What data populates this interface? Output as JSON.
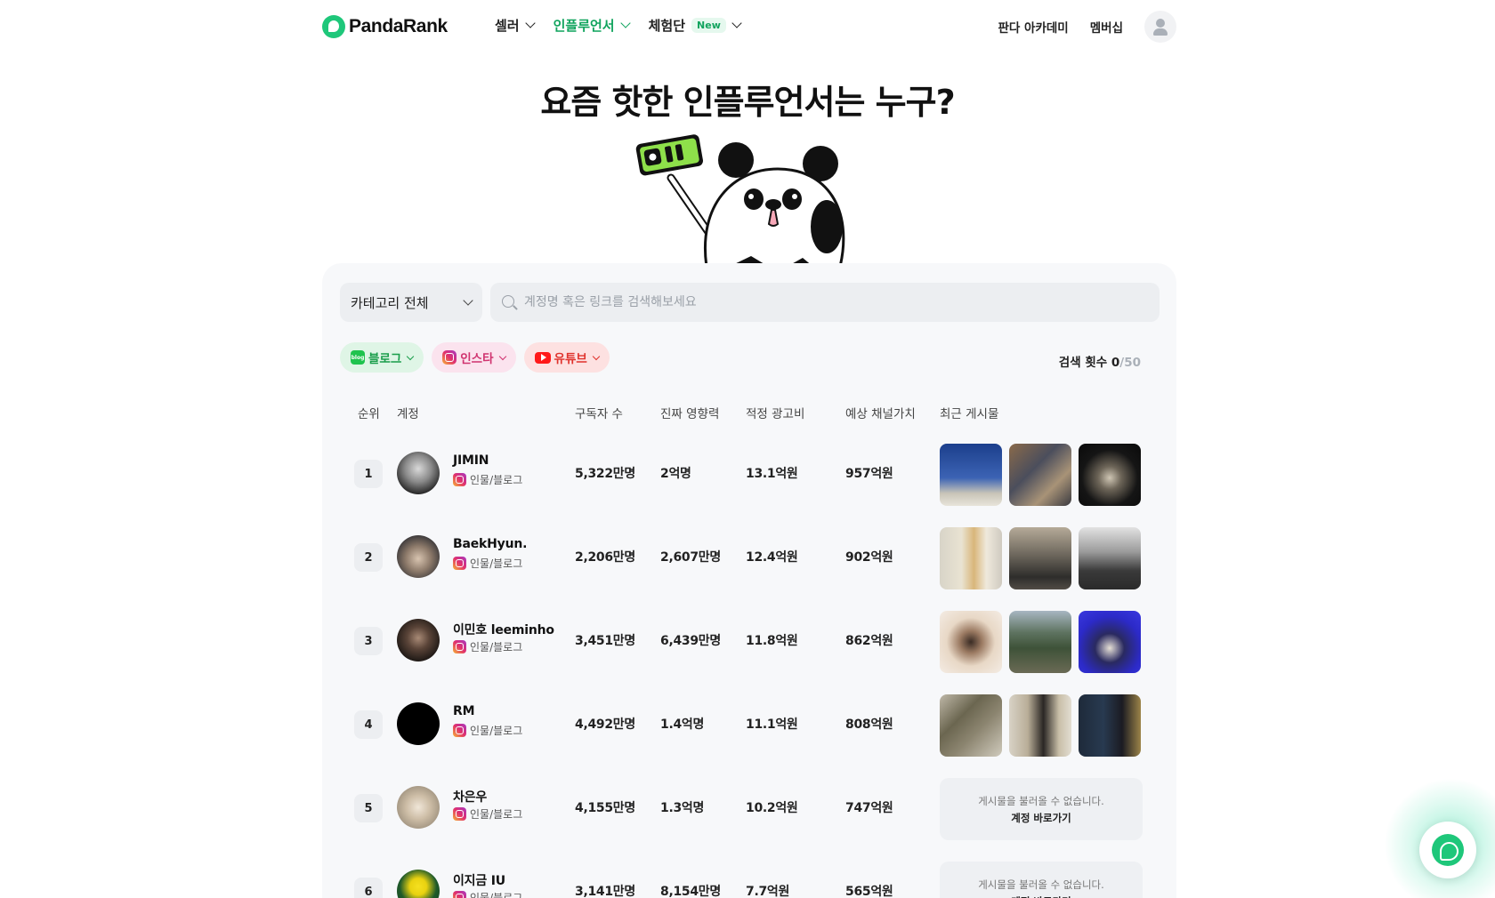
{
  "brand": {
    "name": "PandaRank",
    "accent": "#11a45e"
  },
  "nav": [
    {
      "label": "셀러",
      "active": false
    },
    {
      "label": "인플루언서",
      "active": true
    },
    {
      "label": "체험단",
      "badge": "New",
      "active": false
    }
  ],
  "header_links": {
    "academy": "판다 아카데미",
    "membership": "멤버십"
  },
  "hero": {
    "title": "요즘 핫한 인플루언서는 누구?"
  },
  "filters": {
    "category": "카테고리 전체",
    "search_placeholder": "계정명 혹은 링크를 검색해보세요",
    "chips": [
      {
        "label": "블로그",
        "icon": "blog-icon"
      },
      {
        "label": "인스타",
        "icon": "instagram-icon"
      },
      {
        "label": "유튜브",
        "icon": "youtube-icon"
      }
    ],
    "search_count_label": "검색 횟수",
    "search_count": "0",
    "search_count_max": "/50"
  },
  "table": {
    "headers": {
      "rank": "순위",
      "account": "계정",
      "subscribers": "구독자 수",
      "influence": "진짜 영향력",
      "ad_cost": "적정 광고비",
      "channel_value": "예상 채널가치",
      "recent_posts": "최근 게시물"
    },
    "rows": [
      {
        "rank": "1",
        "name": "JIMIN",
        "category": "인물/블로그",
        "subscribers": "5,322만명",
        "influence": "2억명",
        "ad_cost": "13.1억원",
        "channel_value": "957억원"
      },
      {
        "rank": "2",
        "name": "BaekHyun.",
        "category": "인물/블로그",
        "subscribers": "2,206만명",
        "influence": "2,607만명",
        "ad_cost": "12.4억원",
        "channel_value": "902억원"
      },
      {
        "rank": "3",
        "name": "이민호 leeminho",
        "category": "인물/블로그",
        "subscribers": "3,451만명",
        "influence": "6,439만명",
        "ad_cost": "11.8억원",
        "channel_value": "862억원"
      },
      {
        "rank": "4",
        "name": "RM",
        "category": "인물/블로그",
        "subscribers": "4,492만명",
        "influence": "1.4억명",
        "ad_cost": "11.1억원",
        "channel_value": "808억원"
      },
      {
        "rank": "5",
        "name": "차은우",
        "category": "인물/블로그",
        "subscribers": "4,155만명",
        "influence": "1.3억명",
        "ad_cost": "10.2억원",
        "channel_value": "747억원"
      },
      {
        "rank": "6",
        "name": "이지금 IU",
        "category": "인물/블로그",
        "subscribers": "3,141만명",
        "influence": "8,154만명",
        "ad_cost": "7.7억원",
        "channel_value": "565억원"
      }
    ],
    "no_posts_message": "게시물을 불러올 수 없습니다.",
    "no_posts_link": "계정 바로가기"
  }
}
